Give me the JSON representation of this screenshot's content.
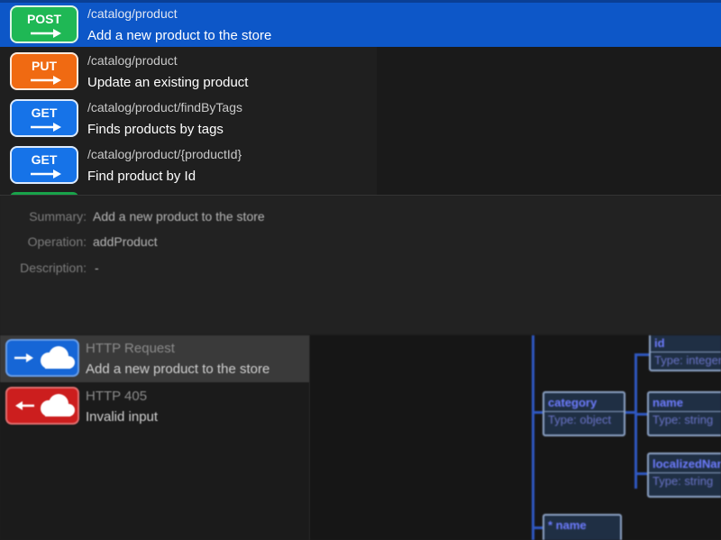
{
  "operations": [
    {
      "method": "POST",
      "color": "#1fb855",
      "path": "/catalog/product",
      "description": "Add a new product to the store",
      "selected": true
    },
    {
      "method": "PUT",
      "color": "#f06a12",
      "path": "/catalog/product",
      "description": "Update an existing product",
      "selected": false
    },
    {
      "method": "GET",
      "color": "#1673e8",
      "path": "/catalog/product/findByTags",
      "description": "Finds products by tags",
      "selected": false
    },
    {
      "method": "GET",
      "color": "#1673e8",
      "path": "/catalog/product/{productId}",
      "description": "Find product by Id",
      "selected": false
    }
  ],
  "details": {
    "summary_label": "Summary:",
    "summary_value": "Add a new product to the store",
    "operation_label": "Operation:",
    "operation_value": "addProduct",
    "description_label": "Description:",
    "description_value": "-"
  },
  "messages": [
    {
      "title": "HTTP Request",
      "description": "Add a new product to the store",
      "icon": "cloud-request-icon",
      "color": "#1666d6",
      "selected": true
    },
    {
      "title": "HTTP 405",
      "description": "Invalid input",
      "icon": "cloud-response-icon",
      "color": "#cc1e1e",
      "selected": false
    }
  ],
  "schema": {
    "nodes": [
      {
        "name": "id",
        "type": "Type: integer"
      },
      {
        "name": "category",
        "type": "Type: object"
      },
      {
        "name": "name",
        "type": "Type: string"
      },
      {
        "name": "localizedName",
        "type": "Type: string"
      },
      {
        "name": "* name",
        "type": ""
      }
    ]
  },
  "colors": {
    "selection": "#0d57c8",
    "post": "#1fb855",
    "put": "#f06a12",
    "get": "#1673e8",
    "error": "#cc1e1e"
  }
}
